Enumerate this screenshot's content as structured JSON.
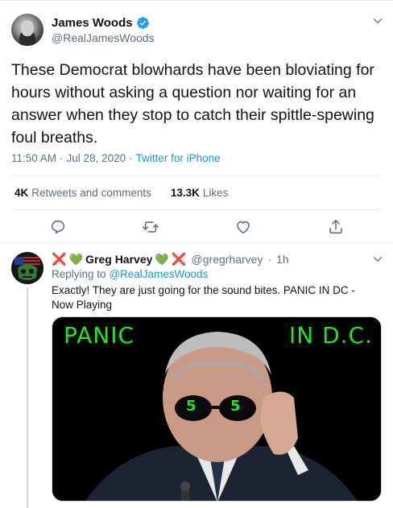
{
  "tweet": {
    "author_name": "James Woods",
    "author_handle": "@RealJamesWoods",
    "text": "These Democrat blowhards have been bloviating for hours without asking a question nor waiting for an answer when they stop to catch their spittle-spewing foul breaths.",
    "time": "11:50 AM",
    "date": "Jul 28, 2020",
    "separator": "·",
    "source": "Twitter for iPhone",
    "retweets_count": "4K",
    "retweets_label": "Retweets and comments",
    "likes_count": "13.3K",
    "likes_label": "Likes",
    "actions": [
      "comment-icon",
      "retweet-icon",
      "like-icon",
      "share-icon"
    ]
  },
  "reply": {
    "name_prefix_x": "❌",
    "name_prefix_heart": "💚",
    "author_name": "Greg Harvey",
    "name_suffix_heart": "💚",
    "name_suffix_x": "❌",
    "author_handle": "@gregrharvey",
    "separator": "·",
    "age": "1h",
    "replying_label": "Replying to",
    "replying_to": "@RealJamesWoods",
    "text": "Exactly! They are just going for the sound bites. PANIC IN DC - Now Playing",
    "media": {
      "left_text": "PANIC",
      "right_text": "IN D.C.",
      "lens_left": "5",
      "lens_right": "5"
    }
  },
  "colors": {
    "link": "#1b95e0",
    "secondary": "#5b7083",
    "verified": "#1da1f2",
    "media_text": "#1ee81e",
    "x_mark": "#e0245e",
    "heart": "#4caf50"
  }
}
